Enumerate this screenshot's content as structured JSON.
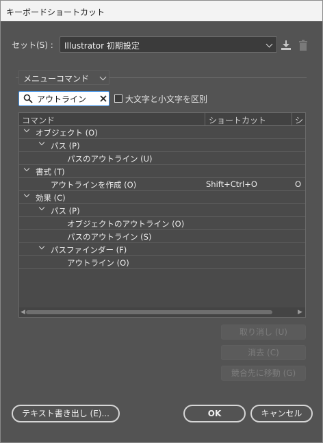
{
  "window": {
    "title": "キーボードショートカット"
  },
  "set": {
    "label": "セット(S) :",
    "value": "Illustrator 初期設定"
  },
  "category": {
    "value": "メニューコマンド"
  },
  "search": {
    "value": "アウトライン"
  },
  "case_checkbox": {
    "label": "大文字と小文字を区別",
    "checked": false
  },
  "table": {
    "headers": [
      "コマンド",
      "ショートカット",
      "シ"
    ],
    "rows": [
      {
        "label": "オブジェクト (O)",
        "shortcut": "",
        "extra": ""
      },
      {
        "label": "パス (P)",
        "shortcut": "",
        "extra": ""
      },
      {
        "label": "パスのアウトライン (U)",
        "shortcut": "",
        "extra": ""
      },
      {
        "label": "書式 (T)",
        "shortcut": "",
        "extra": ""
      },
      {
        "label": "アウトラインを作成 (O)",
        "shortcut": "Shift+Ctrl+O",
        "extra": "O"
      },
      {
        "label": "効果 (C)",
        "shortcut": "",
        "extra": ""
      },
      {
        "label": "パス (P)",
        "shortcut": "",
        "extra": ""
      },
      {
        "label": "オブジェクトのアウトライン (O)",
        "shortcut": "",
        "extra": ""
      },
      {
        "label": "パスのアウトライン (S)",
        "shortcut": "",
        "extra": ""
      },
      {
        "label": "パスファインダー (F)",
        "shortcut": "",
        "extra": ""
      },
      {
        "label": "アウトライン (O)",
        "shortcut": "",
        "extra": ""
      }
    ]
  },
  "buttons": {
    "undo": "取り消し (U)",
    "clear": "消去 (C)",
    "goto_conflict": "競合先に移動 (G)",
    "export_text": "テキスト書き出し (E)...",
    "ok": "OK",
    "cancel": "キャンセル"
  },
  "icons": {
    "download": "download-icon",
    "trash": "trash-icon",
    "search": "search-icon",
    "clear": "close-icon"
  }
}
